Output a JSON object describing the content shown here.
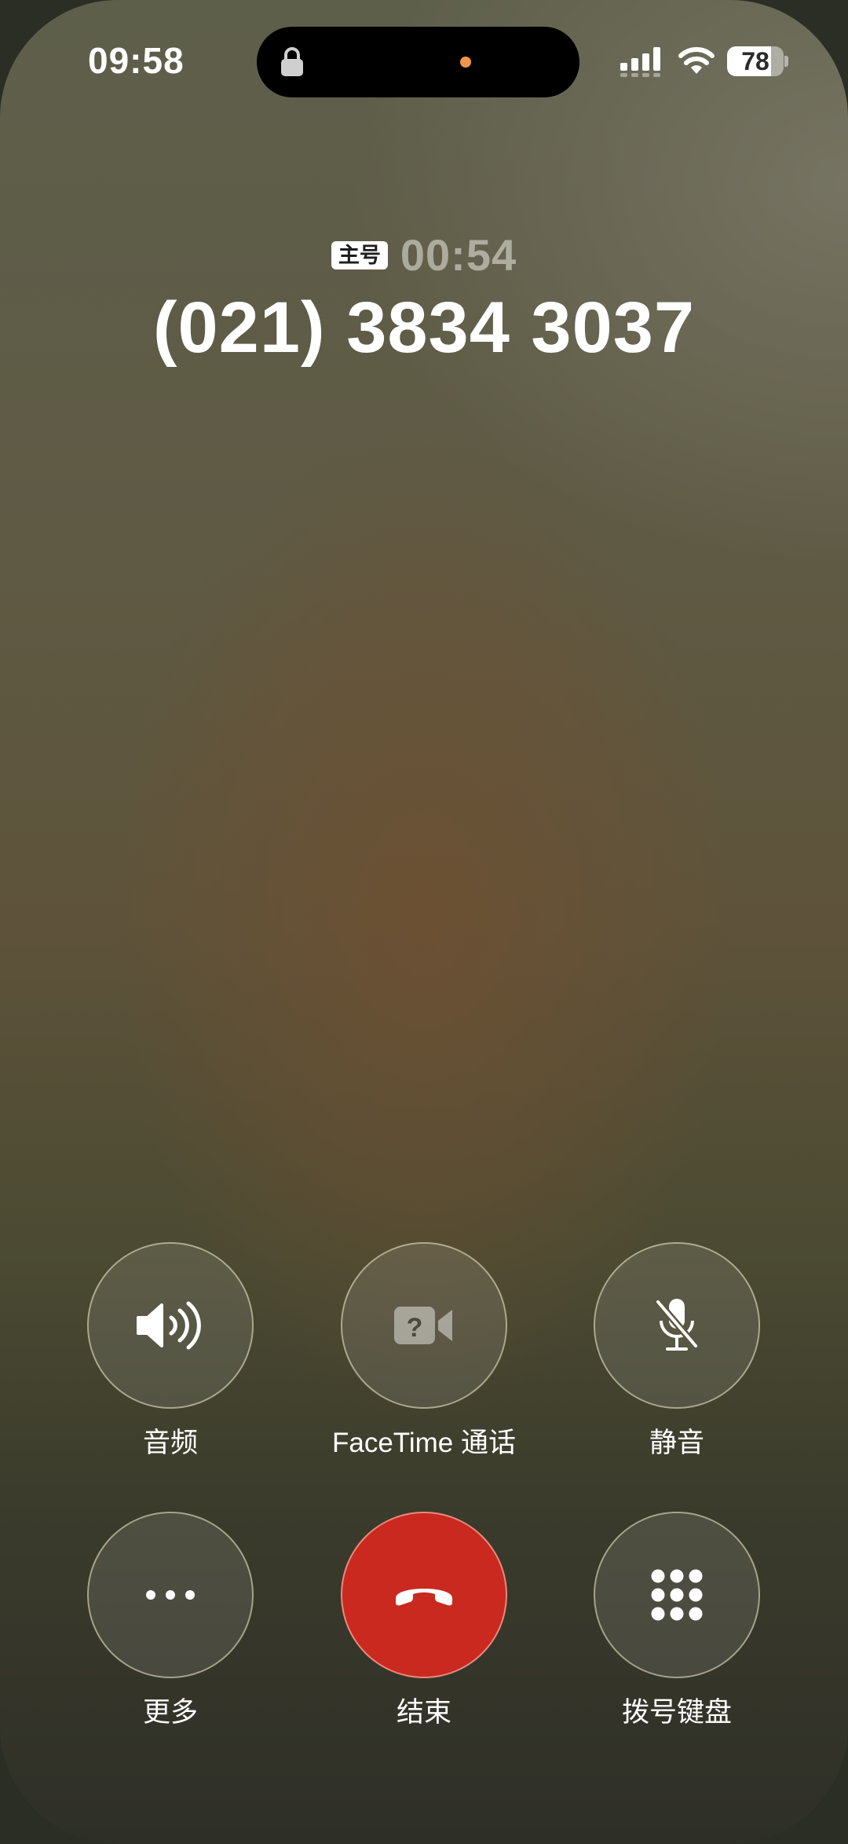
{
  "status_bar": {
    "time": "09:58",
    "battery_level": "78",
    "battery_percent": 78,
    "icons": [
      "lock-icon",
      "signal-icon",
      "wifi-icon",
      "battery-icon"
    ],
    "indicator_color": "#f0954b"
  },
  "call": {
    "line_badge": "主号",
    "duration": "00:54",
    "number": "(021) 3834 3037"
  },
  "controls": {
    "audio_label": "音频",
    "facetime_label": "FaceTime 通话",
    "mute_label": "静音",
    "more_label": "更多",
    "end_label": "结束",
    "keypad_label": "拨号键盘",
    "end_color": "#c9291f",
    "icons": [
      "speaker-icon",
      "facetime-video-icon",
      "mic-off-icon",
      "more-dots-icon",
      "hang-up-icon",
      "keypad-icon"
    ]
  }
}
